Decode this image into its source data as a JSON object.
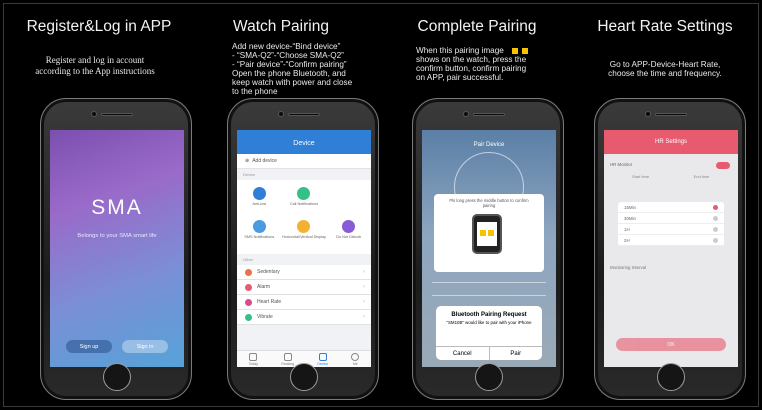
{
  "columns": [
    {
      "title": "Register&Log in APP",
      "desc_lines": [
        "Register and log in account",
        "according to the App instructions"
      ],
      "screen": {
        "logo": "SMA",
        "tagline": "Belongs to your SMA smart life",
        "signup": "Sign up",
        "signin": "Sign in"
      }
    },
    {
      "title": "Watch Pairing",
      "desc_lines": [
        "Add new device-“Bind device”",
        "- “SMA-Q2”-“Choose SMA-Q2”",
        "- “Pair device”-“Confirm pairing”",
        "Open the phone Bluetooth, and",
        "keep watch with power and close",
        "to the phone"
      ],
      "screen": {
        "header": "Device",
        "add_device": "Add device",
        "section_device": "Device",
        "grid": [
          "Anti-lost",
          "Call Notifications",
          "SMS Notifications",
          "Horizontal/Vertical Display",
          "Do Not Disturb"
        ],
        "section_other": "Other",
        "rows": [
          "Sedentary",
          "Alarm",
          "Heart Rate",
          "Vibrate"
        ],
        "tabs": [
          "Today",
          "Ranking",
          "Device",
          "Me"
        ]
      }
    },
    {
      "title": "Complete Pairing",
      "desc_lines": [
        "When this pairing image",
        "shows on the watch, press the",
        "confirm button, confirm pairing",
        "on APP, pair successful."
      ],
      "screen": {
        "header": "Pair Device",
        "hint": "Pls long press the middle button to confirm pairing",
        "dialog_title": "Bluetooth Pairing Request",
        "dialog_msg": "\"SM10B\" would like to pair with your iPhone",
        "cancel": "Cancel",
        "pair": "Pair"
      }
    },
    {
      "title": "Heart Rate Settings",
      "desc_lines": [
        "Go to APP-Device-Heart Rate,",
        "choose the time and frequency."
      ],
      "screen": {
        "header": "HR Settings",
        "hr_monitor": "HR Monitor",
        "start_time": "Start time",
        "end_time": "End time",
        "options": [
          "15Min",
          "30Min",
          "1H",
          "2H"
        ],
        "monitoring_interval": "Monitoring Interval",
        "ok": "OK"
      }
    }
  ],
  "colors": {
    "accent_blue": "#2f7fd6",
    "accent_pink": "#e85a6e",
    "pair_yellow": "#f4c400"
  }
}
